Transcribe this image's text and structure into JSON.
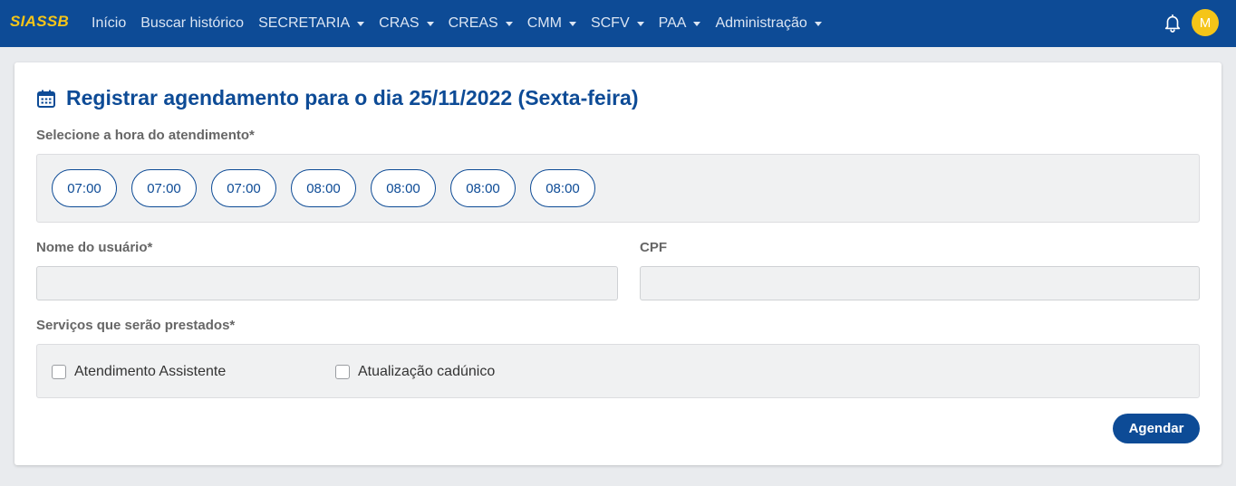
{
  "nav": {
    "brand": "SIASSB",
    "items": [
      {
        "label": "Início",
        "dropdown": false
      },
      {
        "label": "Buscar histórico",
        "dropdown": false
      },
      {
        "label": "SECRETARIA",
        "dropdown": true
      },
      {
        "label": "CRAS",
        "dropdown": true
      },
      {
        "label": "CREAS",
        "dropdown": true
      },
      {
        "label": "CMM",
        "dropdown": true
      },
      {
        "label": "SCFV",
        "dropdown": true
      },
      {
        "label": "PAA",
        "dropdown": true
      },
      {
        "label": "Administração",
        "dropdown": true
      }
    ],
    "avatar_initial": "M",
    "bell_icon": "bell-icon"
  },
  "form": {
    "title": "Registrar agendamento para o dia 25/11/2022 (Sexta-feira)",
    "calendar_icon": "calendar-icon",
    "time_label": "Selecione a hora do atendimento*",
    "times": [
      "07:00",
      "07:00",
      "07:00",
      "08:00",
      "08:00",
      "08:00",
      "08:00"
    ],
    "user_name_label": "Nome do usuário*",
    "user_name_value": "",
    "cpf_label": "CPF",
    "cpf_value": "",
    "services_label": "Serviços que serão prestados*",
    "services": [
      {
        "label": "Atendimento Assistente",
        "checked": false
      },
      {
        "label": "Atualização cadúnico",
        "checked": false
      }
    ],
    "submit_label": "Agendar"
  },
  "colors": {
    "primary": "#0d4b96",
    "brand_yellow": "#f5c518",
    "panel_bg": "#f0f1f2"
  }
}
